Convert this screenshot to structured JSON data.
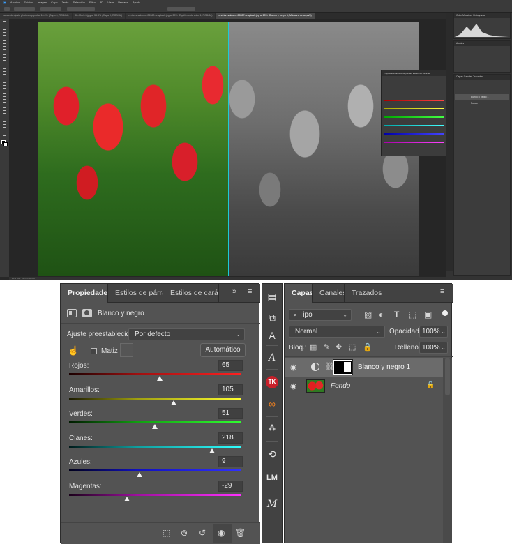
{
  "top_screenshot": {
    "menu": [
      "Archivo",
      "Edición",
      "Imagen",
      "Capa",
      "Texto",
      "Selección",
      "Filtro",
      "3D",
      "Vista",
      "Ventana",
      "Ayuda"
    ],
    "doc_tabs": [
      {
        "label": "capas de ajuste photoshop.psd al 16.6% (Capa 0, RGB/8#)",
        "active": false
      },
      {
        "label": "file-Mark-3.jpg al 33.3% (Capa 0, RGB/8#)",
        "active": false
      },
      {
        "label": "vertices-salonne-26360-unsplash.jpg al 25% (Equilibrio de color 1, RGB/8#)",
        "active": false
      },
      {
        "label": "andrian-valeanu-26527-unsplash.jpg al 25% (Blanco y negro 1, Máscara de capa/8)",
        "active": true
      }
    ],
    "status_text": "25%     Doc: 22,5 M/30,4 M",
    "right_dock": {
      "histogram_tabs": "Color  Muestras  Histograma",
      "adjust_tab": "Ajustes",
      "layers_tabs": "Capas  Canales  Trazados",
      "layer_names": [
        "Blanco y negro 1",
        "Fondo"
      ]
    },
    "float_props_title": "Propiedades  Estilos de párrafo  Estilos de carácter"
  },
  "properties": {
    "tabs": [
      "Propiedades",
      "Estilos de párrafo",
      "Estilos de carácter"
    ],
    "expand_icon": "»",
    "menu_icon": "≡",
    "layer_type_label": "Blanco y negro",
    "preset_label": "Ajuste preestablecido:",
    "preset_value": "Por defecto",
    "tint_label": "Matiz",
    "auto_button": "Automático",
    "sliders": [
      {
        "label": "Rojos:",
        "value": "65",
        "position": 0.53
      },
      {
        "label": "Amarillos:",
        "value": "105",
        "position": 0.61
      },
      {
        "label": "Verdes:",
        "value": "51",
        "position": 0.5
      },
      {
        "label": "Cianes:",
        "value": "218",
        "position": 0.83
      },
      {
        "label": "Azules:",
        "value": "9",
        "position": 0.41
      },
      {
        "label": "Magentas:",
        "value": "-29",
        "position": 0.34
      }
    ]
  },
  "layers": {
    "tabs": [
      "Capas",
      "Canales",
      "Trazados"
    ],
    "filter_value": "Tipo",
    "blend_mode": "Normal",
    "opacity_label": "Opacidad:",
    "opacity_value": "100%",
    "lock_label": "Bloq.:",
    "fill_label": "Relleno:",
    "fill_value": "100%",
    "rows": [
      {
        "name": "Blanco y negro 1",
        "selected": true
      },
      {
        "name": "Fondo",
        "selected": false
      }
    ]
  },
  "colors": {
    "panel_bg": "#535353",
    "tab_bg": "#424242",
    "guide": "#1ec8d8"
  }
}
